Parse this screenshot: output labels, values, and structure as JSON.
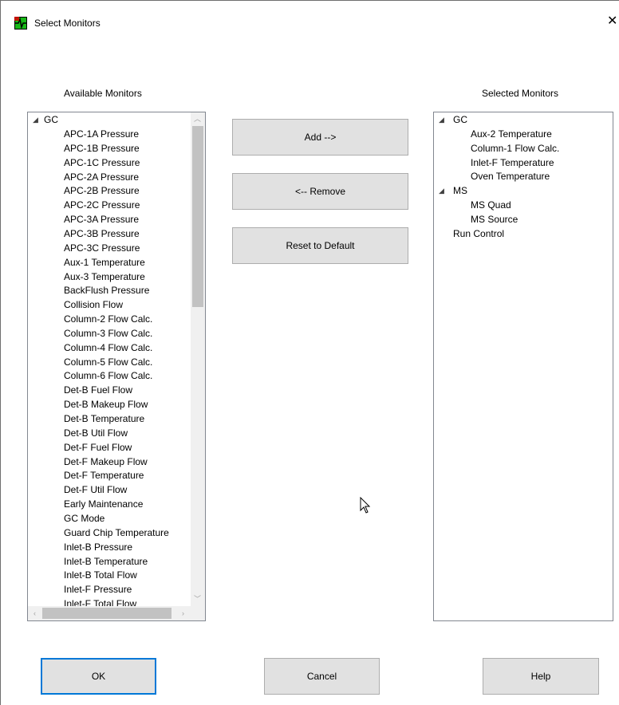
{
  "window": {
    "title": "Select Monitors",
    "close_glyph": "✕",
    "icon": "monitor-app-icon"
  },
  "available": {
    "label": "Available Monitors",
    "root": "GC",
    "items": [
      "APC-1A Pressure",
      "APC-1B Pressure",
      "APC-1C Pressure",
      "APC-2A Pressure",
      "APC-2B Pressure",
      "APC-2C Pressure",
      "APC-3A Pressure",
      "APC-3B Pressure",
      "APC-3C Pressure",
      "Aux-1 Temperature",
      "Aux-3 Temperature",
      "BackFlush Pressure",
      "Collision Flow",
      "Column-2 Flow Calc.",
      "Column-3 Flow Calc.",
      "Column-4 Flow Calc.",
      "Column-5 Flow Calc.",
      "Column-6 Flow Calc.",
      "Det-B Fuel Flow",
      "Det-B Makeup Flow",
      "Det-B Temperature",
      "Det-B Util Flow",
      "Det-F Fuel Flow",
      "Det-F Makeup Flow",
      "Det-F Temperature",
      "Det-F Util Flow",
      "Early Maintenance",
      "GC Mode",
      "Guard Chip Temperature",
      "Inlet-B Pressure",
      "Inlet-B Temperature",
      "Inlet-B Total Flow",
      "Inlet-F Pressure",
      "Inlet-F Total Flow"
    ]
  },
  "selected": {
    "label": "Selected Monitors",
    "groups": [
      {
        "name": "GC",
        "children": [
          "Aux-2 Temperature",
          "Column-1 Flow Calc.",
          "Inlet-F Temperature",
          "Oven Temperature"
        ]
      },
      {
        "name": "MS",
        "children": [
          "MS Quad",
          "MS Source"
        ]
      }
    ],
    "root_items": [
      "Run Control"
    ]
  },
  "buttons": {
    "add": "Add -->",
    "remove": "<-- Remove",
    "reset": "Reset to Default",
    "ok": "OK",
    "cancel": "Cancel",
    "help": "Help"
  },
  "colors": {
    "button_face": "#e1e1e1",
    "default_border": "#0078d7",
    "list_border": "#828790"
  }
}
